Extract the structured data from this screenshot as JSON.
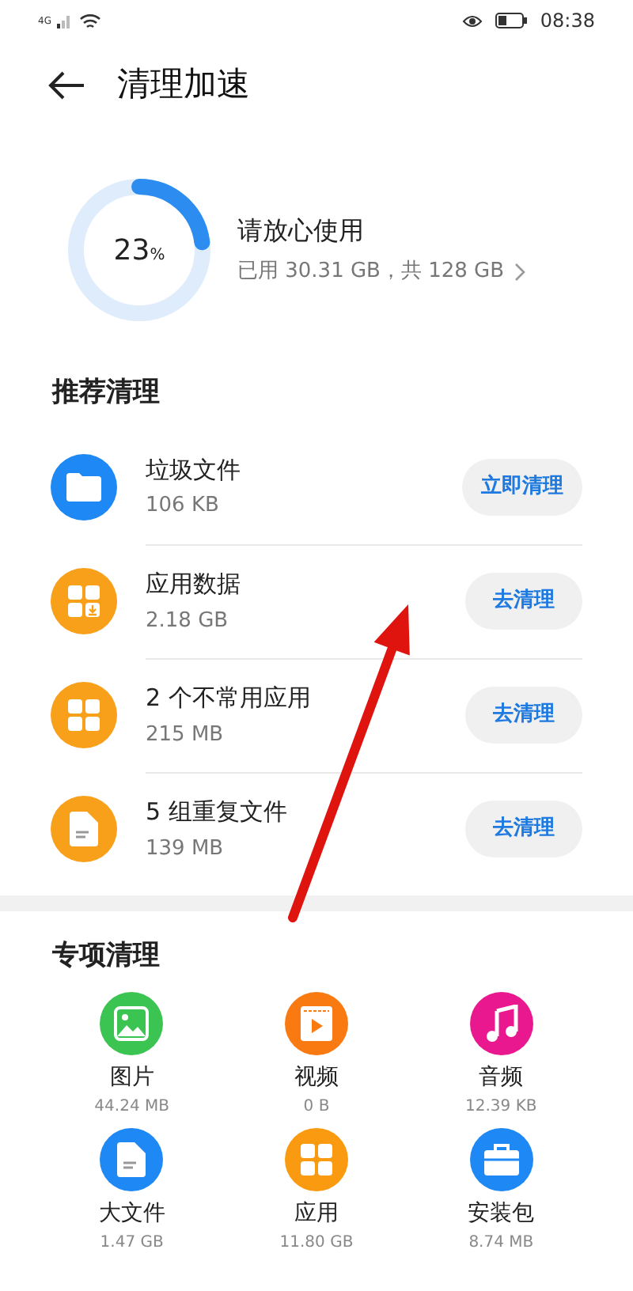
{
  "status_bar": {
    "network": "4G",
    "time": "08:38"
  },
  "header": {
    "title": "清理加速"
  },
  "storage": {
    "level": 0.23,
    "percent": "23",
    "unit": "%",
    "status": "请放心使用",
    "usage": "已用 30.31 GB，共 128 GB"
  },
  "recommended": {
    "title": "推荐清理",
    "items": [
      {
        "kind": "folder",
        "color": "#1e88f5",
        "name": "垃圾文件",
        "size": "106 KB",
        "action": "立即清理"
      },
      {
        "kind": "appdata",
        "color": "#f9a01b",
        "name": "应用数据",
        "size": "2.18 GB",
        "action": "去清理"
      },
      {
        "kind": "apps",
        "color": "#f9a01b",
        "name": "2 个不常用应用",
        "size": "215 MB",
        "action": "去清理"
      },
      {
        "kind": "file",
        "color": "#f9a01b",
        "name": "5 组重复文件",
        "size": "139 MB",
        "action": "去清理"
      }
    ]
  },
  "special": {
    "title": "专项清理",
    "items": [
      {
        "kind": "image",
        "color": "#3cc453",
        "name": "图片",
        "size": "44.24 MB"
      },
      {
        "kind": "video",
        "color": "#fa7a12",
        "name": "视频",
        "size": "0 B"
      },
      {
        "kind": "music",
        "color": "#e9188e",
        "name": "音频",
        "size": "12.39 KB"
      },
      {
        "kind": "doc",
        "color": "#1e88f5",
        "name": "大文件",
        "size": "1.47 GB"
      },
      {
        "kind": "apps",
        "color": "#fa9a10",
        "name": "应用",
        "size": "11.80 GB"
      },
      {
        "kind": "package",
        "color": "#1e88f5",
        "name": "安装包",
        "size": "8.74 MB"
      }
    ]
  }
}
